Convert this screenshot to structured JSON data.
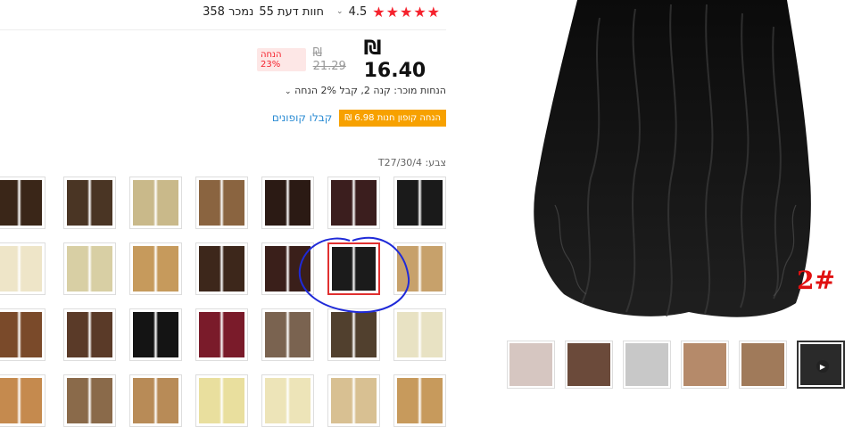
{
  "rating": {
    "stars": "★★★★★",
    "score": "4.5",
    "reviews": "55 חוות דעת",
    "sold": "358 נמכר"
  },
  "price": {
    "current": "₪ 16.40",
    "original": "₪ 21.29",
    "discount": "הנחה 23%"
  },
  "sale": {
    "text": "הנחות מוכר: קנה 2, קבל 2% הנחה"
  },
  "coupon": {
    "badge": "₪ 6.98 הנחה קופון חנות",
    "link": "קבלו קופונים"
  },
  "color": {
    "label": "צבע: T27/30/4"
  },
  "swatches": [
    {
      "name": "black-waves",
      "color": "#1a1a1a"
    },
    {
      "name": "dark-auburn",
      "color": "#3b1e1e"
    },
    {
      "name": "dark-brown-mix",
      "color": "#2b1a14"
    },
    {
      "name": "light-brown",
      "color": "#8a6440"
    },
    {
      "name": "ash-blonde",
      "color": "#c9b98a"
    },
    {
      "name": "brown-highlight",
      "color": "#4a3524"
    },
    {
      "name": "chestnut",
      "color": "#3a2618"
    },
    {
      "name": "golden-wave",
      "color": "#c7a16b"
    },
    {
      "name": "jet-black-curly",
      "color": "#1b1b1b"
    },
    {
      "name": "mahogany",
      "color": "#3a1f1a"
    },
    {
      "name": "dark-curly",
      "color": "#3d271b"
    },
    {
      "name": "honey",
      "color": "#c69a5c"
    },
    {
      "name": "platinum-wave",
      "color": "#d8cfa4"
    },
    {
      "name": "pale-blonde",
      "color": "#eee5c8"
    },
    {
      "name": "light-blonde",
      "color": "#e8e2c3"
    },
    {
      "name": "mix-wave",
      "color": "#51402e"
    },
    {
      "name": "ombre",
      "color": "#7a6350"
    },
    {
      "name": "burgundy",
      "color": "#7a1b2a"
    },
    {
      "name": "black-straight",
      "color": "#141414"
    },
    {
      "name": "brown-straight",
      "color": "#5a3a28"
    },
    {
      "name": "auburn-straight",
      "color": "#7a4a2a"
    },
    {
      "name": "honey-straight",
      "color": "#c79a5c"
    },
    {
      "name": "sand-straight",
      "color": "#d8c092"
    },
    {
      "name": "cream-straight",
      "color": "#ede4b8"
    },
    {
      "name": "blonde-straight",
      "color": "#e9df9e"
    },
    {
      "name": "dark-golden",
      "color": "#b88b57"
    },
    {
      "name": "mix-straight",
      "color": "#8a6a4a"
    },
    {
      "name": "ginger",
      "color": "#c58a4e"
    }
  ],
  "main_image": {
    "label": "2#"
  },
  "thumbnails": [
    {
      "name": "thumb-blurred-1",
      "color": "#d6c6c1"
    },
    {
      "name": "thumb-hair-pieces",
      "color": "#6b4a3a"
    },
    {
      "name": "thumb-blurred-2",
      "color": "#c8c8c8"
    },
    {
      "name": "thumb-color-chart-1",
      "color": "#b58a6a"
    },
    {
      "name": "thumb-color-chart-2",
      "color": "#a07a5a"
    },
    {
      "name": "thumb-video",
      "color": "#2a2a2a"
    }
  ],
  "colors": {
    "accent": "#f5222d",
    "coupon": "#f7a100",
    "link": "#2a8bd3",
    "annotation": "#1f2ad8"
  }
}
